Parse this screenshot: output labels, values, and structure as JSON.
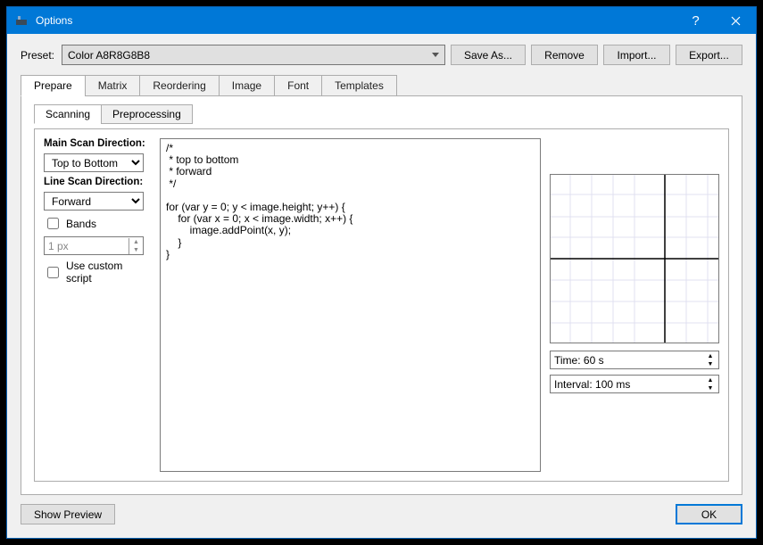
{
  "window": {
    "title": "Options"
  },
  "titlebar_buttons": {
    "help": "?",
    "close": "✕"
  },
  "preset": {
    "label": "Preset:",
    "value": "Color A8R8G8B8",
    "save_as": "Save As...",
    "remove": "Remove",
    "import": "Import...",
    "export": "Export..."
  },
  "tabs": {
    "prepare": "Prepare",
    "matrix": "Matrix",
    "reordering": "Reordering",
    "image": "Image",
    "font": "Font",
    "templates": "Templates"
  },
  "subtabs": {
    "scanning": "Scanning",
    "preprocessing": "Preprocessing"
  },
  "scanning": {
    "main_dir_label": "Main Scan Direction:",
    "main_dir_value": "Top to Bottom",
    "line_dir_label": "Line Scan Direction:",
    "line_dir_value": "Forward",
    "bands_label": "Bands",
    "bands_value": "1 px",
    "custom_script_label": "Use custom script"
  },
  "code": "/*\n * top to bottom\n * forward\n */\n\nfor (var y = 0; y < image.height; y++) {\n    for (var x = 0; x < image.width; x++) {\n        image.addPoint(x, y);\n    }\n}",
  "preview": {
    "time": "Time: 60 s",
    "interval": "Interval: 100 ms"
  },
  "footer": {
    "show_preview": "Show Preview",
    "ok": "OK"
  }
}
